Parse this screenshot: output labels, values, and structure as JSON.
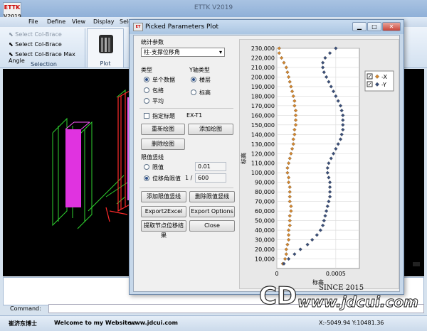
{
  "app": {
    "logo_text": "ETTK",
    "logo_sub": "V2019",
    "title": "ETTK V2019"
  },
  "menu": [
    "File",
    "Define",
    "View",
    "Display",
    "Sele"
  ],
  "ribbon": {
    "selection_items": [
      "Select Col-Brace",
      "Select Col-Brace",
      "Select Col-Brace Max Angle"
    ],
    "selection_group": "Selection",
    "plot_group": "Plot"
  },
  "command": {
    "label": "Command:"
  },
  "status": {
    "author": "崔济东博士",
    "welcome": "Welcome to my Website :",
    "url": "www.jdcui.com",
    "coords": "X:-5049.94 Y:10481.36"
  },
  "dialog": {
    "title": "Picked Parameters Plot",
    "stat_param_label": "统计参数",
    "stat_param_value": "柱-支撑位移角",
    "type_label": "类型",
    "type_options": [
      "单个数据",
      "包络",
      "平均"
    ],
    "yaxis_label": "Y轴类型",
    "yaxis_options": [
      "楼层",
      "标高"
    ],
    "specify_title": "指定标题",
    "specify_title_value": "EX-T1",
    "redraw": "重新绘图",
    "add_plot": "添加绘图",
    "delete_plot": "删除绘图",
    "limit_label": "限值竖线",
    "limit_value_label": "限值",
    "limit_value": "0.01",
    "drift_limit_label": "位移角限值",
    "drift_prefix": "1 /",
    "drift_limit": "600",
    "add_limit": "添加限值竖线",
    "delete_limit": "删除限值竖线",
    "export_excel": "Export2Excel",
    "export_options": "Export Options",
    "extract": "提取节点位移结果",
    "close": "Close"
  },
  "chart_data": {
    "type": "scatter",
    "xlabel": "标高",
    "ylabel": "标高",
    "xlim": [
      0,
      0.0007
    ],
    "ylim": [
      0,
      230000
    ],
    "xticks": [
      "0",
      "0.0005"
    ],
    "yticks": [
      "10,000",
      "20,000",
      "30,000",
      "40,000",
      "50,000",
      "60,000",
      "70,000",
      "80,000",
      "90,000",
      "100,000",
      "110,000",
      "120,000",
      "130,000",
      "140,000",
      "150,000",
      "160,000",
      "170,000",
      "180,000",
      "190,000",
      "200,000",
      "210,000",
      "220,000",
      "230,000"
    ],
    "legend": [
      {
        "name": "-X",
        "color": "#d4872e"
      },
      {
        "name": "-Y",
        "color": "#3a4f7a"
      }
    ],
    "legend_position": "top-right",
    "series": [
      {
        "name": "-X",
        "color": "#d4872e",
        "points": [
          [
            5e-05,
            5000
          ],
          [
            7e-05,
            10000
          ],
          [
            8e-05,
            15000
          ],
          [
            8e-05,
            20000
          ],
          [
            9e-05,
            25000
          ],
          [
            0.0001,
            30000
          ],
          [
            0.0001,
            35000
          ],
          [
            0.0001,
            40000
          ],
          [
            0.00011,
            45000
          ],
          [
            0.00011,
            50000
          ],
          [
            0.00011,
            55000
          ],
          [
            0.00012,
            60000
          ],
          [
            0.00012,
            65000
          ],
          [
            0.00011,
            70000
          ],
          [
            0.00011,
            75000
          ],
          [
            0.00011,
            80000
          ],
          [
            0.00011,
            85000
          ],
          [
            0.0001,
            90000
          ],
          [
            0.0001,
            95000
          ],
          [
            9e-05,
            100000
          ],
          [
            9e-05,
            105000
          ],
          [
            0.0001,
            110000
          ],
          [
            0.00011,
            115000
          ],
          [
            0.00012,
            120000
          ],
          [
            0.00013,
            125000
          ],
          [
            0.00014,
            130000
          ],
          [
            0.00014,
            135000
          ],
          [
            0.00015,
            140000
          ],
          [
            0.00015,
            145000
          ],
          [
            0.00016,
            150000
          ],
          [
            0.00016,
            155000
          ],
          [
            0.00016,
            160000
          ],
          [
            0.00016,
            165000
          ],
          [
            0.00015,
            170000
          ],
          [
            0.00015,
            175000
          ],
          [
            0.00014,
            180000
          ],
          [
            0.00013,
            185000
          ],
          [
            0.00012,
            190000
          ],
          [
            0.00011,
            195000
          ],
          [
            0.0001,
            200000
          ],
          [
            9e-05,
            205000
          ],
          [
            8e-05,
            210000
          ],
          [
            6e-05,
            215000
          ],
          [
            4e-05,
            220000
          ],
          [
            2e-05,
            225000
          ],
          [
            2e-05,
            230000
          ]
        ]
      },
      {
        "name": "-Y",
        "color": "#3a4f7a",
        "points": [
          [
            6e-05,
            5000
          ],
          [
            0.0001,
            10000
          ],
          [
            0.00015,
            15000
          ],
          [
            0.0002,
            20000
          ],
          [
            0.00026,
            25000
          ],
          [
            0.0003,
            30000
          ],
          [
            0.00034,
            35000
          ],
          [
            0.00037,
            40000
          ],
          [
            0.00039,
            45000
          ],
          [
            0.0004,
            50000
          ],
          [
            0.00041,
            55000
          ],
          [
            0.00042,
            60000
          ],
          [
            0.00043,
            65000
          ],
          [
            0.00044,
            70000
          ],
          [
            0.00045,
            75000
          ],
          [
            0.00045,
            80000
          ],
          [
            0.00045,
            85000
          ],
          [
            0.00045,
            90000
          ],
          [
            0.00044,
            95000
          ],
          [
            0.00043,
            100000
          ],
          [
            0.00043,
            105000
          ],
          [
            0.00044,
            110000
          ],
          [
            0.00046,
            115000
          ],
          [
            0.00048,
            120000
          ],
          [
            0.0005,
            125000
          ],
          [
            0.00052,
            130000
          ],
          [
            0.00054,
            135000
          ],
          [
            0.00055,
            140000
          ],
          [
            0.00056,
            145000
          ],
          [
            0.00056,
            150000
          ],
          [
            0.00056,
            155000
          ],
          [
            0.00056,
            160000
          ],
          [
            0.00055,
            165000
          ],
          [
            0.00054,
            170000
          ],
          [
            0.00052,
            175000
          ],
          [
            0.0005,
            180000
          ],
          [
            0.00048,
            185000
          ],
          [
            0.00046,
            190000
          ],
          [
            0.00044,
            195000
          ],
          [
            0.00042,
            200000
          ],
          [
            0.0004,
            205000
          ],
          [
            0.00039,
            210000
          ],
          [
            0.00039,
            215000
          ],
          [
            0.00041,
            220000
          ],
          [
            0.00045,
            225000
          ],
          [
            0.0005,
            230000
          ]
        ]
      }
    ]
  },
  "watermark": {
    "logo": "CD",
    "since": "SINCE 2015",
    "url": "www.jdcui.com"
  }
}
